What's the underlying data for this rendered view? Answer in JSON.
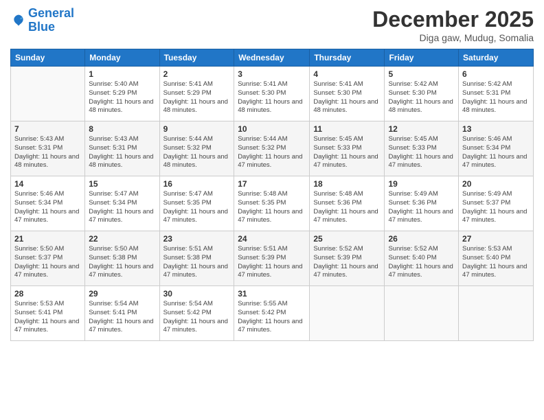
{
  "logo": {
    "line1": "General",
    "line2": "Blue"
  },
  "title": "December 2025",
  "subtitle": "Diga gaw, Mudug, Somalia",
  "days_of_week": [
    "Sunday",
    "Monday",
    "Tuesday",
    "Wednesday",
    "Thursday",
    "Friday",
    "Saturday"
  ],
  "weeks": [
    [
      {
        "day": "",
        "info": ""
      },
      {
        "day": "1",
        "info": "Sunrise: 5:40 AM\nSunset: 5:29 PM\nDaylight: 11 hours\nand 48 minutes."
      },
      {
        "day": "2",
        "info": "Sunrise: 5:41 AM\nSunset: 5:29 PM\nDaylight: 11 hours\nand 48 minutes."
      },
      {
        "day": "3",
        "info": "Sunrise: 5:41 AM\nSunset: 5:30 PM\nDaylight: 11 hours\nand 48 minutes."
      },
      {
        "day": "4",
        "info": "Sunrise: 5:41 AM\nSunset: 5:30 PM\nDaylight: 11 hours\nand 48 minutes."
      },
      {
        "day": "5",
        "info": "Sunrise: 5:42 AM\nSunset: 5:30 PM\nDaylight: 11 hours\nand 48 minutes."
      },
      {
        "day": "6",
        "info": "Sunrise: 5:42 AM\nSunset: 5:31 PM\nDaylight: 11 hours\nand 48 minutes."
      }
    ],
    [
      {
        "day": "7",
        "info": "Sunrise: 5:43 AM\nSunset: 5:31 PM\nDaylight: 11 hours\nand 48 minutes."
      },
      {
        "day": "8",
        "info": "Sunrise: 5:43 AM\nSunset: 5:31 PM\nDaylight: 11 hours\nand 48 minutes."
      },
      {
        "day": "9",
        "info": "Sunrise: 5:44 AM\nSunset: 5:32 PM\nDaylight: 11 hours\nand 48 minutes."
      },
      {
        "day": "10",
        "info": "Sunrise: 5:44 AM\nSunset: 5:32 PM\nDaylight: 11 hours\nand 47 minutes."
      },
      {
        "day": "11",
        "info": "Sunrise: 5:45 AM\nSunset: 5:33 PM\nDaylight: 11 hours\nand 47 minutes."
      },
      {
        "day": "12",
        "info": "Sunrise: 5:45 AM\nSunset: 5:33 PM\nDaylight: 11 hours\nand 47 minutes."
      },
      {
        "day": "13",
        "info": "Sunrise: 5:46 AM\nSunset: 5:34 PM\nDaylight: 11 hours\nand 47 minutes."
      }
    ],
    [
      {
        "day": "14",
        "info": "Sunrise: 5:46 AM\nSunset: 5:34 PM\nDaylight: 11 hours\nand 47 minutes."
      },
      {
        "day": "15",
        "info": "Sunrise: 5:47 AM\nSunset: 5:34 PM\nDaylight: 11 hours\nand 47 minutes."
      },
      {
        "day": "16",
        "info": "Sunrise: 5:47 AM\nSunset: 5:35 PM\nDaylight: 11 hours\nand 47 minutes."
      },
      {
        "day": "17",
        "info": "Sunrise: 5:48 AM\nSunset: 5:35 PM\nDaylight: 11 hours\nand 47 minutes."
      },
      {
        "day": "18",
        "info": "Sunrise: 5:48 AM\nSunset: 5:36 PM\nDaylight: 11 hours\nand 47 minutes."
      },
      {
        "day": "19",
        "info": "Sunrise: 5:49 AM\nSunset: 5:36 PM\nDaylight: 11 hours\nand 47 minutes."
      },
      {
        "day": "20",
        "info": "Sunrise: 5:49 AM\nSunset: 5:37 PM\nDaylight: 11 hours\nand 47 minutes."
      }
    ],
    [
      {
        "day": "21",
        "info": "Sunrise: 5:50 AM\nSunset: 5:37 PM\nDaylight: 11 hours\nand 47 minutes."
      },
      {
        "day": "22",
        "info": "Sunrise: 5:50 AM\nSunset: 5:38 PM\nDaylight: 11 hours\nand 47 minutes."
      },
      {
        "day": "23",
        "info": "Sunrise: 5:51 AM\nSunset: 5:38 PM\nDaylight: 11 hours\nand 47 minutes."
      },
      {
        "day": "24",
        "info": "Sunrise: 5:51 AM\nSunset: 5:39 PM\nDaylight: 11 hours\nand 47 minutes."
      },
      {
        "day": "25",
        "info": "Sunrise: 5:52 AM\nSunset: 5:39 PM\nDaylight: 11 hours\nand 47 minutes."
      },
      {
        "day": "26",
        "info": "Sunrise: 5:52 AM\nSunset: 5:40 PM\nDaylight: 11 hours\nand 47 minutes."
      },
      {
        "day": "27",
        "info": "Sunrise: 5:53 AM\nSunset: 5:40 PM\nDaylight: 11 hours\nand 47 minutes."
      }
    ],
    [
      {
        "day": "28",
        "info": "Sunrise: 5:53 AM\nSunset: 5:41 PM\nDaylight: 11 hours\nand 47 minutes."
      },
      {
        "day": "29",
        "info": "Sunrise: 5:54 AM\nSunset: 5:41 PM\nDaylight: 11 hours\nand 47 minutes."
      },
      {
        "day": "30",
        "info": "Sunrise: 5:54 AM\nSunset: 5:42 PM\nDaylight: 11 hours\nand 47 minutes."
      },
      {
        "day": "31",
        "info": "Sunrise: 5:55 AM\nSunset: 5:42 PM\nDaylight: 11 hours\nand 47 minutes."
      },
      {
        "day": "",
        "info": ""
      },
      {
        "day": "",
        "info": ""
      },
      {
        "day": "",
        "info": ""
      }
    ]
  ]
}
